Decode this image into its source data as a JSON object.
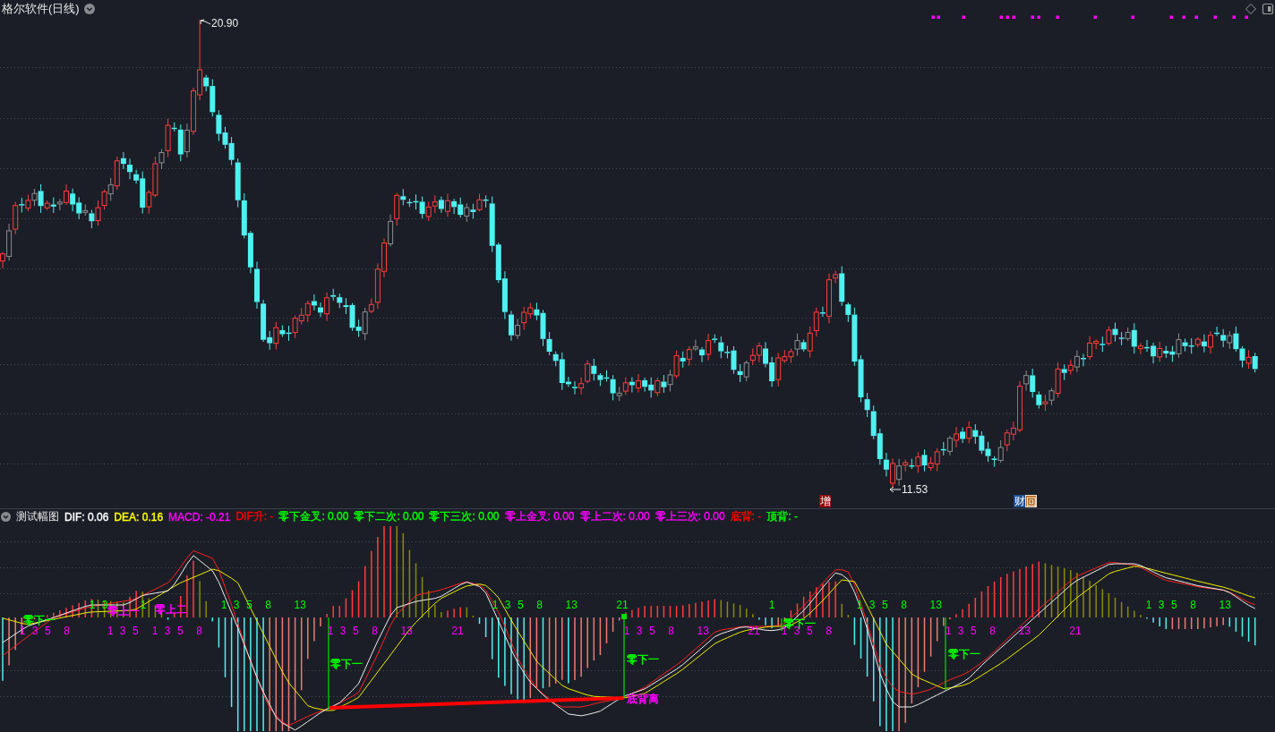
{
  "price_panel": {
    "title": "格尔软件(日线)",
    "high_label": "20.90",
    "low_label": "11.53",
    "event_badges": [
      {
        "text": "增",
        "kind": "add_shares"
      },
      {
        "text": "财",
        "kind": "financial_report"
      },
      {
        "text": "回",
        "kind": "buyback"
      }
    ]
  },
  "indicator_panel": {
    "title": "测试幅图",
    "readouts": [
      {
        "text": "DIF: 0.06",
        "color": "#ffffff"
      },
      {
        "text": "DEA: 0.16",
        "color": "#ffff00"
      },
      {
        "text": "MACD: -0.21",
        "color": "#ff00ff"
      },
      {
        "text": "DIF升: -",
        "color": "#ff0000"
      },
      {
        "text": "零下金叉: 0.00",
        "color": "#00ff00"
      },
      {
        "text": "零下二次: 0.00",
        "color": "#00ff00"
      },
      {
        "text": "零下三次: 0.00",
        "color": "#00ff00"
      },
      {
        "text": "零上金叉: 0.00",
        "color": "#ff00ff"
      },
      {
        "text": "零上二次: 0.00",
        "color": "#ff00ff"
      },
      {
        "text": "零上三次: 0.00",
        "color": "#ff00ff"
      },
      {
        "text": "底背: -",
        "color": "#ff0000"
      },
      {
        "text": "顶背: -",
        "color": "#00ff00"
      }
    ],
    "count_sequences": [
      {
        "color": "#ff00ff",
        "numbers": [
          "1",
          "3",
          "5",
          "8"
        ]
      },
      {
        "color": "#00ff00",
        "numbers": [
          "1",
          "3"
        ]
      },
      {
        "color": "#ff00ff",
        "numbers": [
          "1",
          "3",
          "5"
        ]
      },
      {
        "color": "#00ff00",
        "numbers": [
          "1"
        ]
      },
      {
        "color": "#ff00ff",
        "numbers": [
          "1",
          "3",
          "5",
          "8"
        ]
      },
      {
        "color": "#00ff00",
        "numbers": [
          "1",
          "3",
          "5",
          "8",
          "13"
        ]
      },
      {
        "color": "#ff00ff",
        "numbers": [
          "1",
          "3",
          "5",
          "8",
          "13",
          "21"
        ]
      },
      {
        "color": "#00ff00",
        "numbers": [
          "1",
          "3",
          "5",
          "8",
          "13",
          "21"
        ]
      },
      {
        "color": "#ff00ff",
        "numbers": [
          "1",
          "3",
          "5",
          "8",
          "13",
          "21"
        ]
      },
      {
        "color": "#00ff00",
        "numbers": [
          "1"
        ]
      },
      {
        "color": "#ff00ff",
        "numbers": [
          "1",
          "3",
          "5",
          "8"
        ]
      },
      {
        "color": "#00ff00",
        "numbers": [
          "1",
          "3",
          "5",
          "8",
          "13"
        ]
      },
      {
        "color": "#ff00ff",
        "numbers": [
          "1",
          "3",
          "5",
          "8",
          "13",
          "21"
        ]
      },
      {
        "color": "#00ff00",
        "numbers": [
          "1",
          "3",
          "5",
          "8",
          "13"
        ]
      }
    ],
    "signal_labels": [
      {
        "text": "零下一",
        "color": "#00ff00"
      },
      {
        "text": "零上一",
        "color": "#ff00ff"
      },
      {
        "text": "零上二",
        "color": "#ff00ff"
      },
      {
        "text": "零下一",
        "color": "#00ff00"
      },
      {
        "text": "零下一",
        "color": "#00ff00"
      },
      {
        "text": "底背离",
        "color": "#ff00ff"
      },
      {
        "text": "零下一",
        "color": "#00ff00"
      },
      {
        "text": "零下一",
        "color": "#00ff00"
      }
    ]
  }
}
